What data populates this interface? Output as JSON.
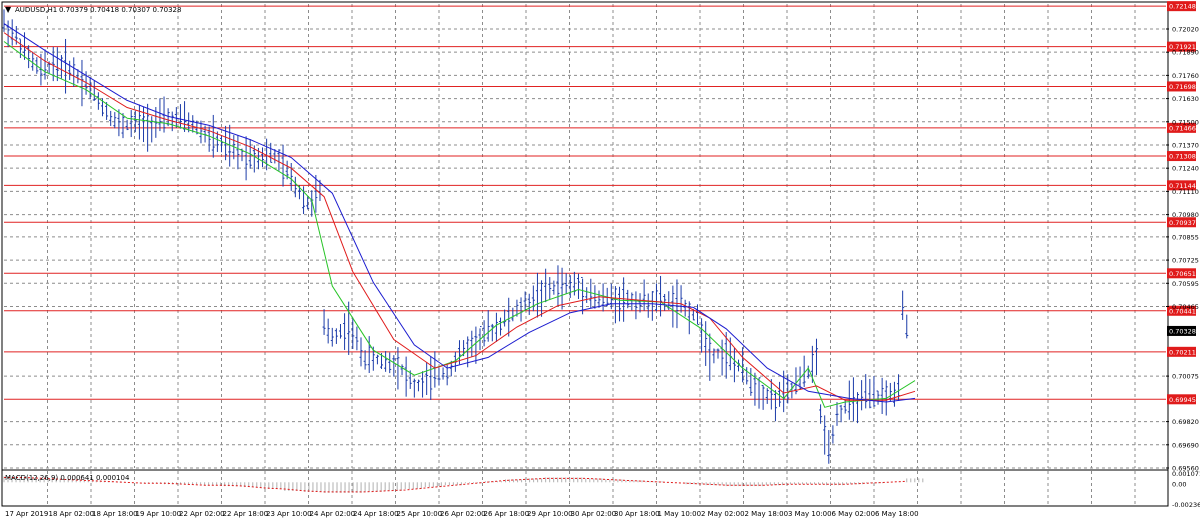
{
  "header": {
    "menu_glyph": "▼",
    "symbol": "AUDUSD,H1",
    "ohlc": "0.70379 0.70418 0.70307 0.70328"
  },
  "indicator": {
    "label": "MACD(12,26,9) 0.000641 0.000104",
    "scale_labels": [
      "0.001071",
      "0.00",
      "-0.002367"
    ]
  },
  "colors": {
    "background": "#ffffff",
    "grid": "#8c8c8c",
    "price_bars": "#1b3ba8",
    "ma_fast": "#27c427",
    "ma_mid": "#e01b1b",
    "ma_slow": "#1c1ccf",
    "level_line": "#e02222",
    "level_label_bg": "#e01b1b",
    "current_label_bg": "#000000",
    "macd_hist": "#b0b0b0",
    "macd_signal": "#e01b1b"
  },
  "chart_data": {
    "type": "line",
    "title": "AUDUSD,H1",
    "ylim": [
      0.6956,
      0.7216
    ],
    "y_ticks": [
      "0.72020",
      "0.71890",
      "0.71760",
      "0.71630",
      "0.71500",
      "0.71370",
      "0.71240",
      "0.71110",
      "0.70980",
      "0.70855",
      "0.70725",
      "0.70595",
      "0.70465",
      "0.70075",
      "0.69820",
      "0.69690",
      "0.69560"
    ],
    "x_tick_labels": [
      "17 Apr 2019",
      "18 Apr 02:00",
      "18 Apr 18:00",
      "19 Apr 10:00",
      "22 Apr 02:00",
      "22 Apr 18:00",
      "23 Apr 10:00",
      "24 Apr 02:00",
      "24 Apr 18:00",
      "25 Apr 10:00",
      "26 Apr 02:00",
      "26 Apr 18:00",
      "29 Apr 10:00",
      "30 Apr 02:00",
      "30 Apr 18:00",
      "1 May 10:00",
      "2 May 02:00",
      "2 May 18:00",
      "3 May 10:00",
      "6 May 02:00",
      "6 May 18:00"
    ],
    "horizontal_levels": [
      "0.72148",
      "0.71921",
      "0.71698",
      "0.71466",
      "0.71308",
      "0.71144",
      "0.70937",
      "0.70651",
      "0.70441",
      "0.70211",
      "0.69945"
    ],
    "current_price": "0.70328",
    "price_path": [
      [
        0,
        0.7205
      ],
      [
        3,
        0.7197
      ],
      [
        6,
        0.7186
      ],
      [
        9,
        0.7178
      ],
      [
        12,
        0.7183
      ],
      [
        16,
        0.718
      ],
      [
        20,
        0.7172
      ],
      [
        24,
        0.7159
      ],
      [
        28,
        0.7148
      ],
      [
        32,
        0.7149
      ],
      [
        36,
        0.7149
      ],
      [
        40,
        0.7152
      ],
      [
        45,
        0.715
      ],
      [
        50,
        0.7141
      ],
      [
        54,
        0.7136
      ],
      [
        58,
        0.7132
      ],
      [
        62,
        0.7131
      ],
      [
        66,
        0.7131
      ],
      [
        70,
        0.7118
      ],
      [
        74,
        0.7104
      ],
      [
        77,
        0.711
      ],
      [
        78,
        0.7035
      ],
      [
        80,
        0.703
      ],
      [
        84,
        0.7035
      ],
      [
        88,
        0.7018
      ],
      [
        92,
        0.7016
      ],
      [
        96,
        0.7015
      ],
      [
        100,
        0.7001
      ],
      [
        104,
        0.7006
      ],
      [
        108,
        0.701
      ],
      [
        112,
        0.7022
      ],
      [
        118,
        0.7032
      ],
      [
        124,
        0.7042
      ],
      [
        130,
        0.7053
      ],
      [
        135,
        0.7058
      ],
      [
        140,
        0.7058
      ],
      [
        145,
        0.705
      ],
      [
        150,
        0.7051
      ],
      [
        155,
        0.7049
      ],
      [
        160,
        0.705
      ],
      [
        165,
        0.7047
      ],
      [
        169,
        0.704
      ],
      [
        172,
        0.7021
      ],
      [
        176,
        0.702
      ],
      [
        180,
        0.701
      ],
      [
        184,
        0.7
      ],
      [
        188,
        0.6994
      ],
      [
        192,
        0.7
      ],
      [
        196,
        0.701
      ],
      [
        198,
        0.7018
      ],
      [
        199,
        0.6985
      ],
      [
        201,
        0.6968
      ],
      [
        203,
        0.6986
      ],
      [
        206,
        0.6992
      ],
      [
        210,
        0.6995
      ],
      [
        214,
        0.6996
      ],
      [
        218,
        0.6999
      ],
      [
        219,
        0.7045
      ],
      [
        220,
        0.7033
      ]
    ],
    "series": [
      {
        "name": "",
        "values": [
          [
            0,
            0.7195
          ],
          [
            10,
            0.7178
          ],
          [
            20,
            0.7168
          ],
          [
            30,
            0.7152
          ],
          [
            40,
            0.7149
          ],
          [
            50,
            0.7142
          ],
          [
            60,
            0.7132
          ],
          [
            70,
            0.7118
          ],
          [
            75,
            0.7106
          ],
          [
            80,
            0.7058
          ],
          [
            90,
            0.7022
          ],
          [
            100,
            0.7008
          ],
          [
            110,
            0.7016
          ],
          [
            120,
            0.7036
          ],
          [
            130,
            0.7048
          ],
          [
            140,
            0.7056
          ],
          [
            150,
            0.705
          ],
          [
            160,
            0.7049
          ],
          [
            170,
            0.7034
          ],
          [
            180,
            0.7012
          ],
          [
            190,
            0.6995
          ],
          [
            196,
            0.7012
          ],
          [
            200,
            0.699
          ],
          [
            205,
            0.6993
          ],
          [
            215,
            0.6995
          ],
          [
            222,
            0.7005
          ]
        ]
      },
      {
        "name": "",
        "values": [
          [
            0,
            0.72
          ],
          [
            10,
            0.7184
          ],
          [
            20,
            0.7172
          ],
          [
            30,
            0.7158
          ],
          [
            40,
            0.7151
          ],
          [
            50,
            0.7145
          ],
          [
            60,
            0.7136
          ],
          [
            70,
            0.7124
          ],
          [
            78,
            0.7108
          ],
          [
            85,
            0.7066
          ],
          [
            95,
            0.7028
          ],
          [
            105,
            0.7012
          ],
          [
            115,
            0.7019
          ],
          [
            125,
            0.7035
          ],
          [
            135,
            0.7047
          ],
          [
            145,
            0.7052
          ],
          [
            155,
            0.705
          ],
          [
            165,
            0.7048
          ],
          [
            172,
            0.704
          ],
          [
            180,
            0.7018
          ],
          [
            190,
            0.6998
          ],
          [
            198,
            0.7002
          ],
          [
            205,
            0.6994
          ],
          [
            215,
            0.6994
          ],
          [
            222,
            0.6999
          ]
        ]
      },
      {
        "name": "",
        "values": [
          [
            0,
            0.7205
          ],
          [
            10,
            0.719
          ],
          [
            20,
            0.7176
          ],
          [
            30,
            0.7162
          ],
          [
            40,
            0.7153
          ],
          [
            50,
            0.7148
          ],
          [
            60,
            0.714
          ],
          [
            70,
            0.713
          ],
          [
            80,
            0.711
          ],
          [
            90,
            0.706
          ],
          [
            100,
            0.7025
          ],
          [
            108,
            0.7012
          ],
          [
            118,
            0.7018
          ],
          [
            128,
            0.7032
          ],
          [
            138,
            0.7043
          ],
          [
            148,
            0.7048
          ],
          [
            158,
            0.7048
          ],
          [
            168,
            0.7046
          ],
          [
            176,
            0.7034
          ],
          [
            186,
            0.7012
          ],
          [
            196,
            0.6999
          ],
          [
            206,
            0.6995
          ],
          [
            215,
            0.6993
          ],
          [
            222,
            0.6995
          ]
        ]
      }
    ],
    "macd": {
      "histogram": [
        0.0006,
        0.0005,
        0.0004,
        0.0003,
        0.0002,
        0.0001,
        0.0,
        -0.0001,
        -0.0002,
        -0.0002,
        -0.0003,
        -0.0004,
        -0.0005,
        -0.0007,
        -0.0009,
        -0.001,
        -0.0011,
        -0.0011,
        -0.001,
        -0.0009,
        -0.0007,
        -0.0005,
        -0.0003,
        -0.0001,
        0.0001,
        0.0003,
        0.0004,
        0.0005,
        0.0005,
        0.0004,
        0.0003,
        0.0002,
        0.0001,
        0.0,
        -0.0002,
        -0.0003,
        -0.0004,
        -0.0004,
        -0.0003,
        -0.0002,
        -0.0002,
        -0.0003,
        -0.0002,
        -0.0001,
        0.0,
        0.0004
      ],
      "signal": [
        0.0005,
        0.0005,
        0.0004,
        0.0003,
        0.0002,
        0.0001,
        0.0,
        -0.0001,
        -0.0001,
        -0.0002,
        -0.0003,
        -0.0003,
        -0.0004,
        -0.0006,
        -0.0007,
        -0.0009,
        -0.001,
        -0.001,
        -0.001,
        -0.0009,
        -0.0008,
        -0.0006,
        -0.0004,
        -0.0002,
        0.0,
        0.0002,
        0.0003,
        0.0004,
        0.0004,
        0.0004,
        0.0003,
        0.0002,
        0.0001,
        0.0,
        -0.0001,
        -0.0002,
        -0.0003,
        -0.0003,
        -0.0003,
        -0.0002,
        -0.0002,
        -0.0002,
        -0.0002,
        -0.0001,
        0.0,
        0.0001
      ],
      "ylim": [
        -0.002367,
        0.001071
      ]
    }
  }
}
